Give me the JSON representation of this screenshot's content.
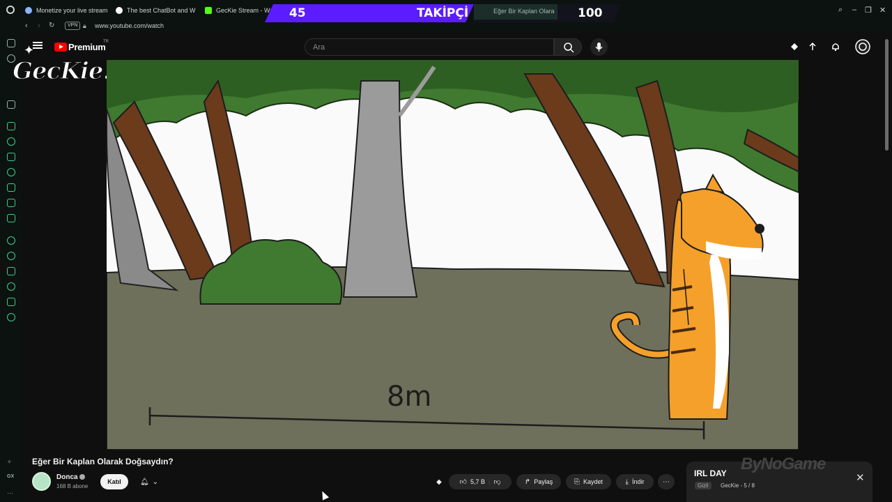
{
  "browser": {
    "tabs": [
      {
        "label": "Monetize your live stream",
        "color": "#8ab4f8"
      },
      {
        "label": "The best ChatBot and W",
        "color": "#ffffff"
      },
      {
        "label": "GecKie Stream - Watc",
        "color": "#53fc18"
      }
    ],
    "url": "www.youtube.com/watch",
    "vpn_label": "VPN"
  },
  "overlay": {
    "follower_count": "45",
    "follower_label": "TAKİPÇİ",
    "goal": "100",
    "hidden_tab": "Eğer Bir Kaplan Olara"
  },
  "youtube": {
    "brand": "Premium",
    "region": "TR",
    "search_placeholder": "Ara"
  },
  "video": {
    "distance_label": "8m",
    "streamer_logo": "GecKie."
  },
  "meta": {
    "title": "Eğer Bir Kaplan Olarak Doğsaydın?",
    "channel": "Donca",
    "subscribers": "168 B abone",
    "join_label": "Katıl",
    "likes": "5,7 B",
    "share_label": "Paylaş",
    "save_label": "Kaydet",
    "download_label": "İndir"
  },
  "playlist": {
    "title": "IRL DAY",
    "privacy": "Gizli",
    "meta": "GecKie - 5 / 8",
    "sponsor": "ByNoGame"
  },
  "colors": {
    "accent_purple": "#5b1cff",
    "youtube_red": "#ff0000",
    "tiger_orange": "#f5a02a"
  }
}
